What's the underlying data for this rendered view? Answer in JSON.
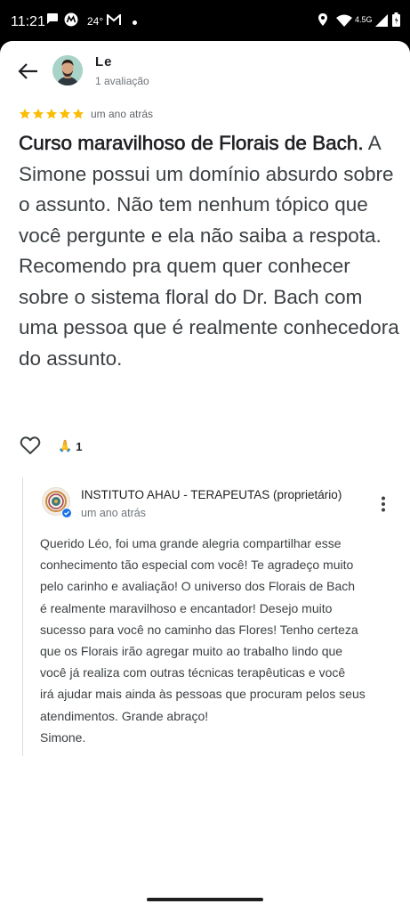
{
  "status_bar": {
    "time": "11:21",
    "temperature": "24°",
    "network": "4.5G",
    "icons": [
      "chat-icon",
      "motorola-icon",
      "gmail-icon",
      "location-icon",
      "wifi-icon",
      "signal-icon",
      "battery-icon"
    ]
  },
  "reviewer": {
    "name": "Le",
    "review_count": "1 avaliação"
  },
  "review": {
    "rating": 5,
    "time": "um ano atrás",
    "text_bold": "Curso maravilhoso de Florais de Bach.",
    "text_rest": " A Simone possui um domínio absurdo sobre o assunto. Não tem nenhum tópico que você pergunte e ela não saiba a respota. Recomendo pra quem quer conhecer sobre o sistema floral do Dr. Bach com uma pessoa que é realmente conhecedora do assunto."
  },
  "reactions": {
    "emoji": "🙏",
    "count": "1"
  },
  "owner_reply": {
    "name": "INSTITUTO AHAU - TERAPEUTAS (proprietário)",
    "time": "um ano atrás",
    "lines": [
      "Querido Léo, foi uma grande alegria compartilhar esse",
      "conhecimento tão especial com você! Te agradeço muito",
      "pelo carinho e avaliação! O universo dos Florais de Bach",
      "é realmente maravilhoso e encantador! Desejo muito",
      "sucesso para você no caminho das Flores! Tenho certeza",
      "que os Florais irão agregar muito ao trabalho lindo que",
      "você já realiza com outras técnicas terapêuticas e você",
      "irá ajudar mais ainda às pessoas que procuram pelos seus",
      "atendimentos. Grande abraço!",
      "Simone."
    ]
  },
  "colors": {
    "star": "#fbbc04",
    "verified": "#1a73e8"
  }
}
